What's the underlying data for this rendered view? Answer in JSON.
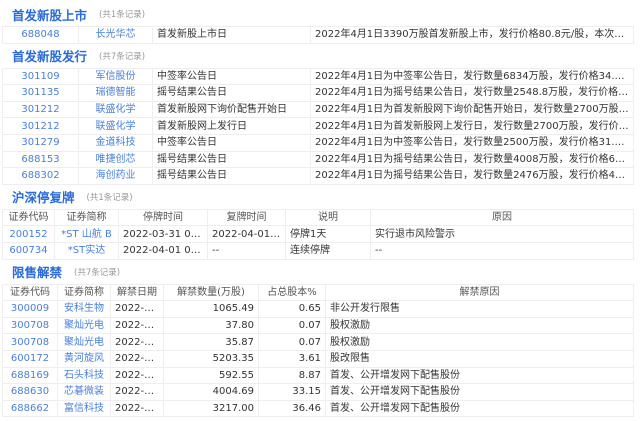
{
  "ipo_listing": {
    "title": "首发新股上市",
    "count": "(共1条记录)",
    "rows": [
      [
        "688048",
        "长光华芯",
        "首发新股上市日",
        "2022年4月1日3390万股首发新股上市，发行价格80.8元/股，本次流通数量..."
      ]
    ]
  },
  "ipo_issue": {
    "title": "首发新股发行",
    "count": "(共7条记录)",
    "rows": [
      [
        "301109",
        "军信股份",
        "中签率公告日",
        "2022年4月1日为中签率公告日，发行数量6834万股，发行价格34.81元/股..."
      ],
      [
        "301135",
        "瑞德智能",
        "摇号结果公告日",
        "2022年4月1日为摇号结果公告日，发行数量2548.8万股，发行价格31.98元..."
      ],
      [
        "301212",
        "联盛化学",
        "首发新股网下询价配售开始日",
        "2022年4月1日为首发新股网下询价配售开始日，发行数量2700万股，发行..."
      ],
      [
        "301212",
        "联盛化学",
        "首发新股网上发行日",
        "2022年4月1日为首发新股网上发行日，发行数量2700万股，发行价格29.67..."
      ],
      [
        "301279",
        "金道科技",
        "中签率公告日",
        "2022年4月1日为中签率公告日，发行数量2500万股，发行价格31.2元/股，..."
      ],
      [
        "688153",
        "唯捷创芯",
        "摇号结果公告日",
        "2022年4月1日为摇号结果公告日，发行数量4008万股，发行价格66.6元/股..."
      ],
      [
        "688302",
        "海创药业",
        "摇号结果公告日",
        "2022年4月1日为摇号结果公告日，发行数量2476万股，发行价格42.92元/..."
      ]
    ]
  },
  "suspension": {
    "title": "沪深停复牌",
    "count": "(共1条记录)",
    "headers": [
      "证券代码",
      "证券简称",
      "停牌时间",
      "复牌时间",
      "说明",
      "原因"
    ],
    "rows": [
      [
        "200152",
        "*ST 山航 B",
        "2022-03-31 09:30",
        "2022-04-01 09:30",
        "停牌1天",
        "实行退市风险警示"
      ],
      [
        "600734",
        "*ST实达",
        "2022-04-01 09:30",
        "--",
        "连续停牌",
        "--"
      ]
    ]
  },
  "unlock": {
    "title": "限售解禁",
    "count": "(共7条记录)",
    "headers": [
      "证券代码",
      "证券简称",
      "解禁日期",
      "解禁数量(万股)",
      "占总股本%",
      "解禁原因"
    ],
    "rows": [
      [
        "300009",
        "安科生物",
        "2022-04-01",
        "1065.49",
        "0.65",
        "非公开发行限售"
      ],
      [
        "300708",
        "聚灿光电",
        "2022-04-01",
        "37.80",
        "0.07",
        "股权激励"
      ],
      [
        "300708",
        "聚灿光电",
        "2022-04-01",
        "35.87",
        "0.07",
        "股权激励"
      ],
      [
        "600172",
        "黄河旋风",
        "2022-04-01",
        "5203.35",
        "3.61",
        "股改限售"
      ],
      [
        "688169",
        "石头科技",
        "2022-04-01",
        "592.55",
        "8.87",
        "首发、公开增发网下配售股份"
      ],
      [
        "688630",
        "芯碁微装",
        "2022-04-01",
        "4004.69",
        "33.15",
        "首发、公开增发网下配售股份"
      ],
      [
        "688662",
        "富信科技",
        "2022-04-01",
        "3217.00",
        "36.46",
        "首发、公开增发网下配售股份"
      ]
    ]
  },
  "colors": {
    "accent": "#2a6bd8",
    "link": "#4a7fd8"
  }
}
